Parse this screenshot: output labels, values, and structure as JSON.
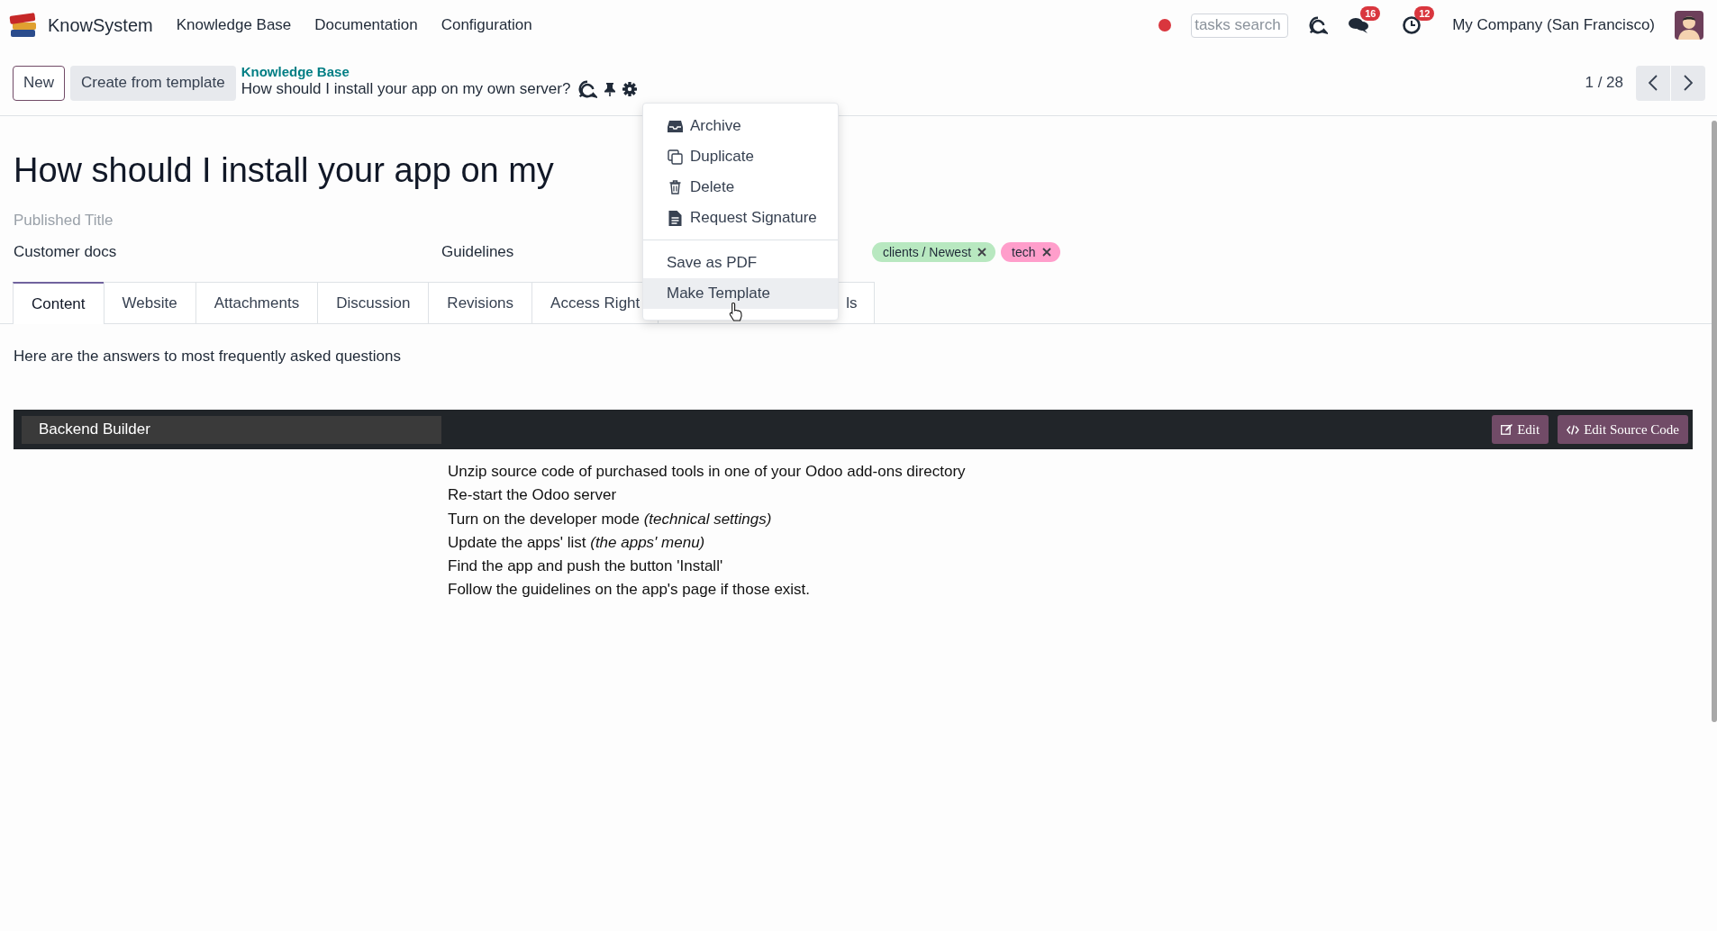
{
  "navbar": {
    "app_name": "KnowSystem",
    "menu": [
      "Knowledge Base",
      "Documentation",
      "Configuration"
    ],
    "search": {
      "placeholder": "tasks search"
    },
    "messages_badge": "16",
    "activities_badge": "12",
    "company": "My Company (San Francisco)"
  },
  "control_panel": {
    "buttons": [
      "New",
      "Create from template"
    ],
    "breadcrumb": "Knowledge Base",
    "record_title": "How should I install your app on my own server?",
    "pager": "1 / 28"
  },
  "actions_menu": {
    "sections": [
      [
        {
          "label": "Archive",
          "kind": "archive",
          "selected": false
        },
        {
          "label": "Duplicate",
          "kind": "copy",
          "selected": false
        },
        {
          "label": "Delete",
          "kind": "trash",
          "selected": false
        },
        {
          "label": "Request Signature",
          "kind": "document",
          "selected": false
        }
      ],
      [
        {
          "label": "Save as PDF",
          "kind": "plain",
          "selected": false
        },
        {
          "label": "Make Template",
          "kind": "plain",
          "selected": true
        }
      ]
    ]
  },
  "form": {
    "title": "How should I install your app on my",
    "published_title": {
      "placeholder": "Published Title"
    },
    "section": "Customer docs",
    "type": "Guidelines",
    "tags": [
      {
        "label": "clients / Newest",
        "color": "#b8e8c0"
      },
      {
        "label": "tech",
        "color": "#ff9ecb"
      }
    ]
  },
  "tabs": [
    {
      "label": "Content",
      "selected": true
    },
    {
      "label": "Website",
      "selected": false
    },
    {
      "label": "Attachments",
      "selected": false
    },
    {
      "label": "Discussion",
      "selected": false
    },
    {
      "label": "Revisions",
      "selected": false
    },
    {
      "label": "Access Right",
      "selected": false
    },
    {
      "label": "ls",
      "selected": false
    }
  ],
  "intro": "Here are the answers to most frequently asked questions",
  "editor": {
    "title_field": "Backend Builder",
    "buttons": [
      "Edit",
      "Edit Source Code"
    ],
    "lines": [
      "Unzip source code of purchased tools in one of your Odoo add-ons directory",
      "Re-start the Odoo server",
      "Turn on the developer mode *(technical settings)*",
      "Update the apps' list *(the apps' menu)*",
      "Find the app and push the button 'Install'",
      "Follow the guidelines on the app's page if those exist."
    ]
  }
}
